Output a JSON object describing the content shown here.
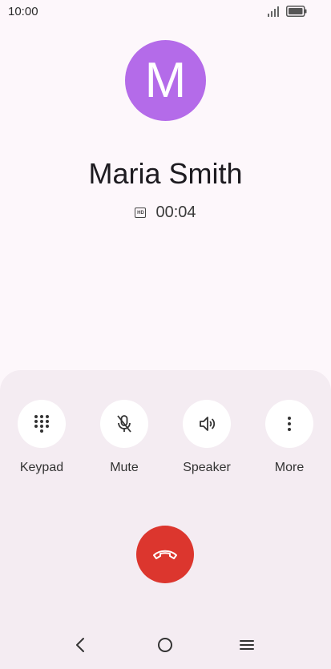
{
  "status_bar": {
    "time": "10:00",
    "signal_icon": "signal-icon",
    "battery_icon": "battery-icon"
  },
  "contact": {
    "initial": "M",
    "name": "Maria Smith",
    "avatar_color": "#b46be9"
  },
  "call": {
    "hd_badge": "HD",
    "duration": "00:04"
  },
  "controls": [
    {
      "label": "Keypad",
      "icon": "keypad-icon"
    },
    {
      "label": "Mute",
      "icon": "mic-off-icon"
    },
    {
      "label": "Speaker",
      "icon": "speaker-icon"
    },
    {
      "label": "More",
      "icon": "more-vert-icon"
    }
  ],
  "end_call": {
    "icon": "end-call-icon",
    "color": "#dc362e"
  },
  "nav": {
    "back_icon": "back-icon",
    "home_icon": "home-icon",
    "recents_icon": "recents-icon"
  },
  "colors": {
    "background": "#fdf7fb",
    "panel": "#f4ecf2"
  }
}
